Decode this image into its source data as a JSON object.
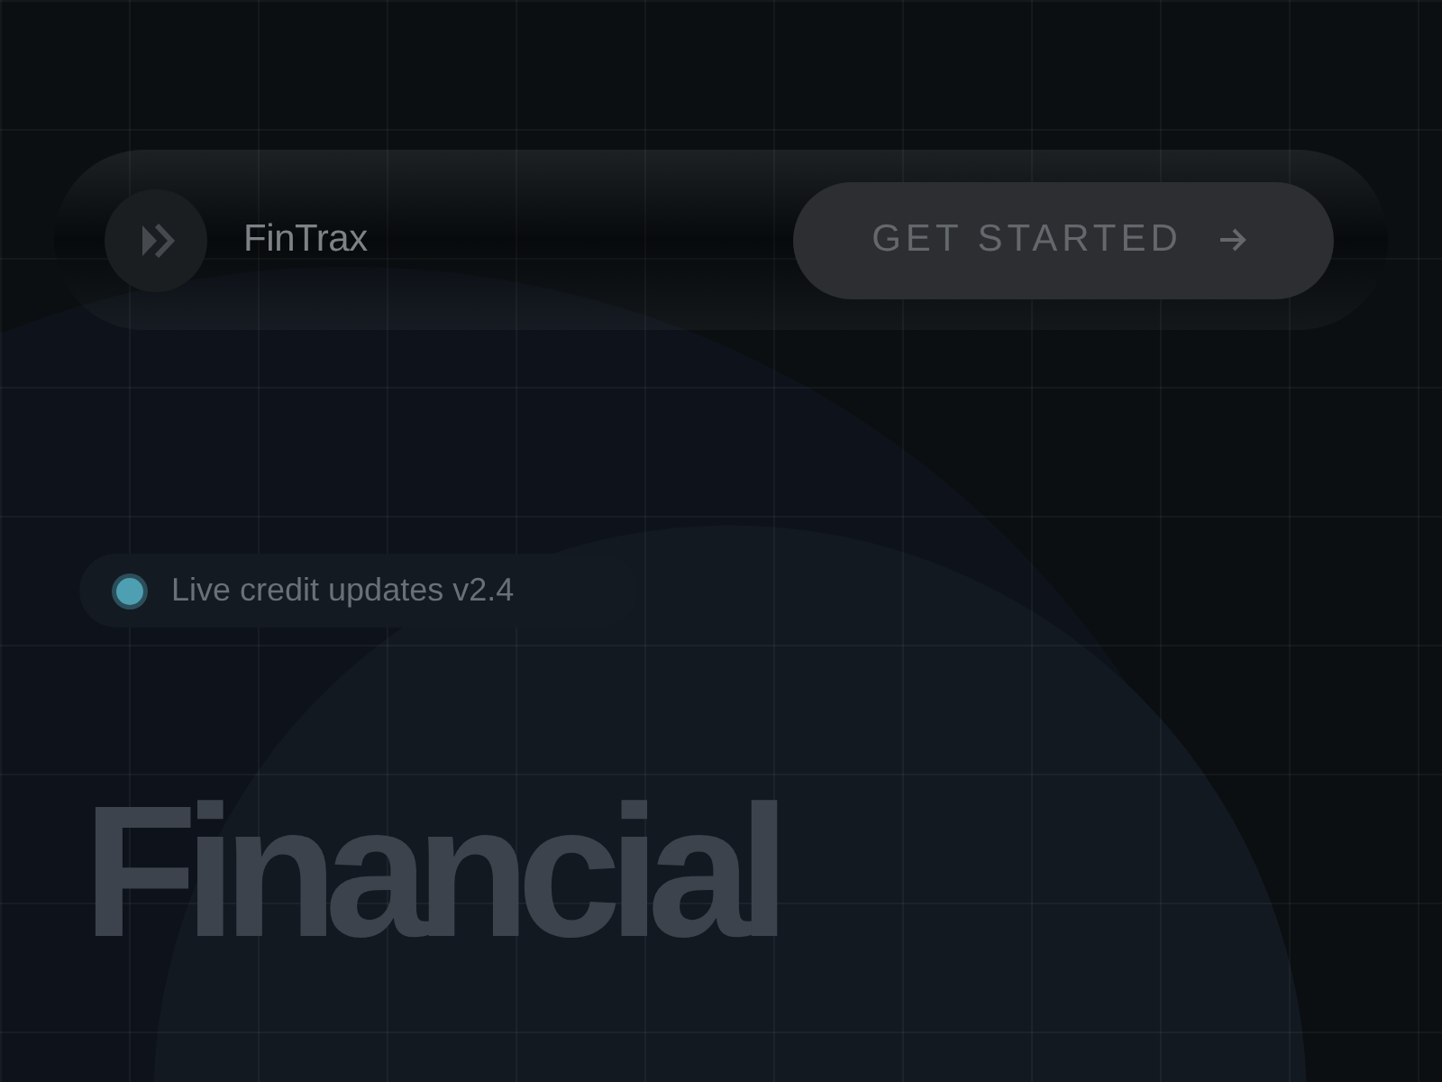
{
  "navbar": {
    "brand": "FinTrax",
    "button": {
      "label": "GET STARTED"
    }
  },
  "badge": {
    "text": "Live credit updates v2.4",
    "live": true
  },
  "hero": {
    "title": "Financial"
  }
}
